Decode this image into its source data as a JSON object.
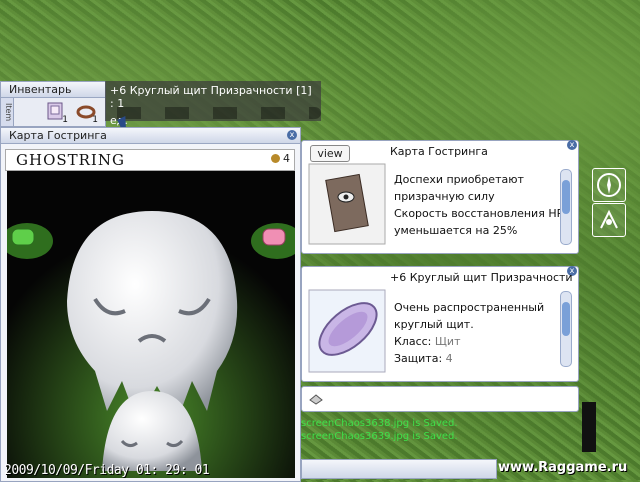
{
  "inventory": {
    "title": "Инвентарь",
    "tab_label": "Item",
    "slots": [
      {
        "icon": "card-album-icon",
        "count": "1"
      },
      {
        "icon": "ring-icon",
        "count": "1"
      }
    ]
  },
  "tooltip": {
    "line1": "+6 Круглый щит Призрачности [1] : 1",
    "line2": "ед."
  },
  "card_window": {
    "title": "Карта Гостринга",
    "card_name": "GHOSTRING",
    "card_cost": "4",
    "timestamp": "2009/10/09/Friday  01: 29: 01"
  },
  "card_desc": {
    "title": "Карта Гостринга",
    "view_label": "view",
    "lines": [
      "Доспехи приобретают",
      "призрачную силу",
      "Скорость восстановления HP",
      "уменьшается на 25%"
    ]
  },
  "shield_desc": {
    "title": "+6 Круглый щит Призрачности",
    "lines": [
      "Очень распространенный",
      "круглый щит."
    ],
    "class_label": "Класс:",
    "class_value": "Щит",
    "defense_label": "Защита:",
    "defense_value": "4"
  },
  "chat": {
    "log": [
      "screenChaos3638.jpg is Saved.",
      "screenChaos3639.jpg is Saved."
    ]
  },
  "watermark": "www.Raggame.ru",
  "colors": {
    "window_border": "#98a4c0",
    "title_bar": "#cfd7e8",
    "chat_text": "#3fe04a"
  }
}
